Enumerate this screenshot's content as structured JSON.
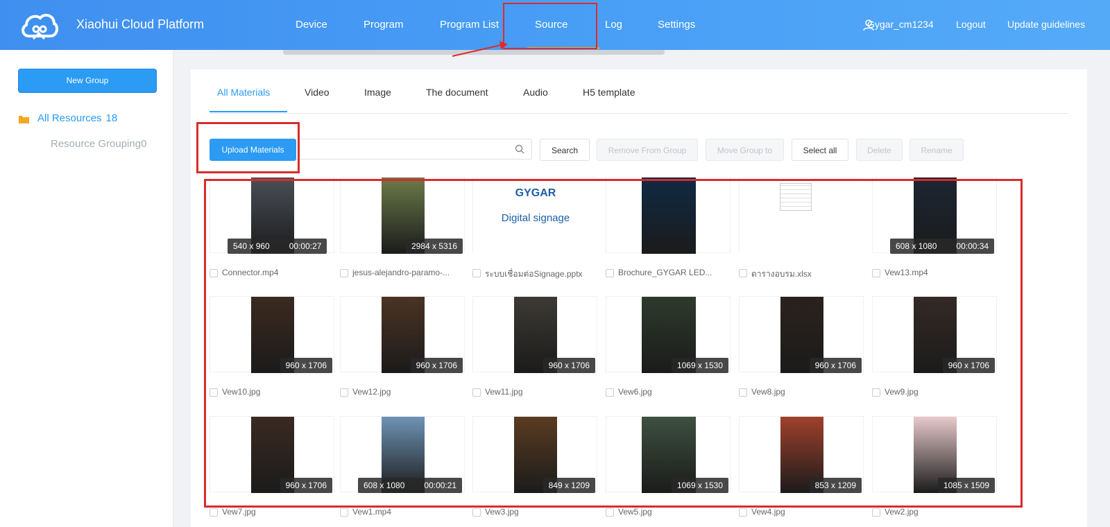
{
  "header": {
    "brand": "Xiaohui Cloud Platform",
    "nav": [
      "Device",
      "Program",
      "Program List",
      "Source",
      "Log",
      "Settings"
    ],
    "active_nav": "Source",
    "username": "Gygar_cm1234",
    "logout": "Logout",
    "update_guidelines": "Update guidelines",
    "colors": {
      "bar": "#4a9cf5",
      "active_underline": "#f5a623"
    }
  },
  "sidebar": {
    "new_group_label": "New Group",
    "all_resources_label": "All Resources",
    "all_resources_count": "18",
    "resource_grouping_label": "Resource Grouping0"
  },
  "tabs": [
    "All Materials",
    "Video",
    "Image",
    "The document",
    "Audio",
    "H5 template"
  ],
  "active_tab": "All Materials",
  "toolbar": {
    "upload_label": "Upload Materials",
    "search_value": "",
    "search_label": "Search",
    "remove_from_group_label": "Remove From Group",
    "move_group_label": "Move Group to",
    "select_all_label": "Select all",
    "delete_label": "Delete",
    "rename_label": "Rename"
  },
  "materials": [
    {
      "name": "Connector.mp4",
      "dims": "540 x 960",
      "duration": "00:00:27",
      "thumb_color": "#4a4f57"
    },
    {
      "name": "jesus-alejandro-paramo-...",
      "dims": "2984 x 5316",
      "duration": "",
      "thumb_color": "#6b7b4a"
    },
    {
      "name": "ระบบเชื่อมต่อSignage.pptx",
      "dims": "",
      "duration": "",
      "thumb_color": "#ffffff",
      "text_brand": "GYGAR",
      "text_sub": "Digital signage"
    },
    {
      "name": "Brochure_GYGAR LED...",
      "dims": "",
      "duration": "",
      "thumb_color": "#0f2a44"
    },
    {
      "name": "ตารางอบรม.xlsx",
      "dims": "",
      "duration": "",
      "thumb_color": "#ffffff"
    },
    {
      "name": "Vew13.mp4",
      "dims": "608 x 1080",
      "duration": "00:00:34",
      "thumb_color": "#1c2633"
    },
    {
      "name": "Vew10.jpg",
      "dims": "960 x 1706",
      "duration": "",
      "thumb_color": "#3b2a20"
    },
    {
      "name": "Vew12.jpg",
      "dims": "960 x 1706",
      "duration": "",
      "thumb_color": "#4a3324"
    },
    {
      "name": "Vew11.jpg",
      "dims": "960 x 1706",
      "duration": "",
      "thumb_color": "#3d3a34"
    },
    {
      "name": "Vew6.jpg",
      "dims": "1069 x 1530",
      "duration": "",
      "thumb_color": "#2e3a2c"
    },
    {
      "name": "Vew8.jpg",
      "dims": "960 x 1706",
      "duration": "",
      "thumb_color": "#2a221c"
    },
    {
      "name": "Vew9.jpg",
      "dims": "960 x 1706",
      "duration": "",
      "thumb_color": "#332a26"
    },
    {
      "name": "Vew7.jpg",
      "dims": "960 x 1706",
      "duration": "",
      "thumb_color": "#3a2a22"
    },
    {
      "name": "Vew1.mp4",
      "dims": "608 x 1080",
      "duration": "00:00:21",
      "thumb_color": "#6f93b6"
    },
    {
      "name": "Vew3.jpg",
      "dims": "849 x 1209",
      "duration": "",
      "thumb_color": "#5a3c22"
    },
    {
      "name": "Vew5.jpg",
      "dims": "1069 x 1530",
      "duration": "",
      "thumb_color": "#3e5040"
    },
    {
      "name": "Vew4.jpg",
      "dims": "853 x 1209",
      "duration": "",
      "thumb_color": "#a0412c"
    },
    {
      "name": "Vew2.jpg",
      "dims": "1085 x 1509",
      "duration": "",
      "thumb_color": "#e8c9cb"
    }
  ]
}
